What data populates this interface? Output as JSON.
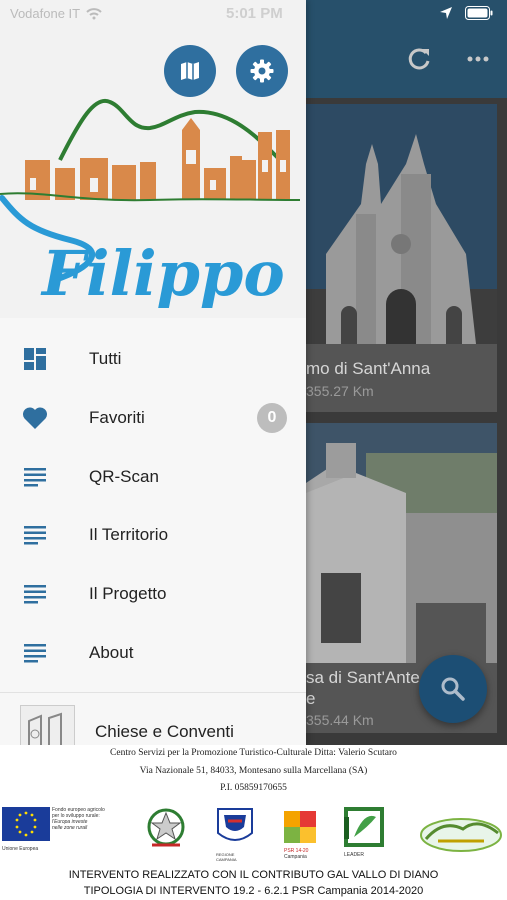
{
  "status_bar": {
    "carrier": "Vodafone IT",
    "time": "5:01 PM"
  },
  "drawer": {
    "header": {
      "logo_text": "Filippo"
    },
    "menu": [
      {
        "label": "Tutti",
        "icon": "dashboard-icon"
      },
      {
        "label": "Favoriti",
        "icon": "heart-icon",
        "badge": "0"
      },
      {
        "label": "QR-Scan",
        "icon": "list-icon"
      },
      {
        "label": "Il Territorio",
        "icon": "list-icon"
      },
      {
        "label": "Il Progetto",
        "icon": "list-icon"
      },
      {
        "label": "About",
        "icon": "list-icon"
      }
    ],
    "recent": {
      "title": "Chiese e Conventi"
    }
  },
  "background_list": {
    "cards": [
      {
        "title": "mo di Sant'Anna",
        "distance": "355.27 Km"
      },
      {
        "title": "sa di Sant'Ante",
        "title_line2": "e",
        "distance": "355.44 Km"
      }
    ]
  },
  "footer": {
    "line1": "Centro Servizi per la Promozione Turistico-Culturale  Ditta: Valerio Scutaro",
    "line2": "Via Nazionale 51, 84033,  Montesano sulla Marcellana (SA)",
    "line3": "P.I. 05859170655",
    "eu_text": [
      "Fondo europeo agricolo",
      "per lo sviluppo rurale:",
      "l'Europa investe",
      "nelle zone rurali"
    ],
    "eu_label": "Unione Europea",
    "campania_label": "REGIONE CAMPANIA",
    "psr_label": "PSR 14-20",
    "psr_sub": "Campania",
    "leader_label": "LEADER",
    "bottom1": "INTERVENTO REALIZZATO CON IL CONTRIBUTO GAL VALLO DI DIANO",
    "bottom2": "TIPOLOGIA DI INTERVENTO 19.2 - 6.2.1 PSR Campania 2014-2020"
  },
  "colors": {
    "accent_blue": "#2f6f9f",
    "topbar": "#27506b",
    "logo_green": "#2e7d32",
    "logo_orange": "#d9894a",
    "logo_blue": "#2a9ad6"
  }
}
